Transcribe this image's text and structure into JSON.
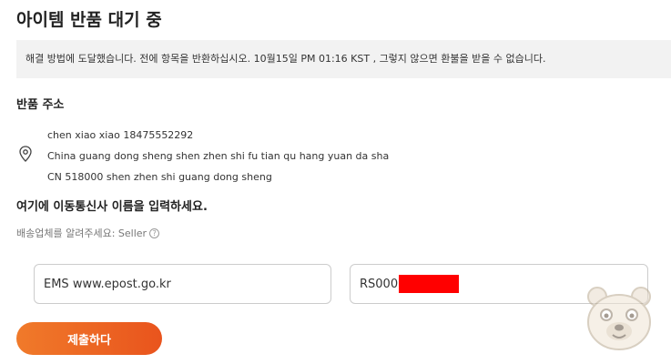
{
  "page": {
    "title": "아이템 반품 대기 중"
  },
  "notice": {
    "text": "해결 방법에 도달했습니다. 전에 항목을 반환하십시오. 10월15일 PM 01:16 KST , 그렇지 않으면 환불을 받을 수 없습니다."
  },
  "return_address": {
    "title": "반품 주소",
    "icon": "location-pin-icon",
    "lines": [
      "chen xiao xiao 18475552292",
      "China guang dong sheng shen zhen shi fu tian qu hang yuan da sha",
      "CN 518000 shen zhen shi guang dong sheng"
    ]
  },
  "carrier": {
    "title": "여기에 이동통신사 이름을 입력하세요.",
    "hint": "배송업체를 알려주세요: Seller",
    "help_icon": "question-circle-icon",
    "carrier_value": "EMS www.epost.go.kr",
    "tracking_value": "RS000"
  },
  "actions": {
    "submit_label": "제출하다",
    "colors": {
      "button_start": "#f07a2a",
      "button_end": "#e9541d",
      "redaction": "#ff0000"
    }
  }
}
